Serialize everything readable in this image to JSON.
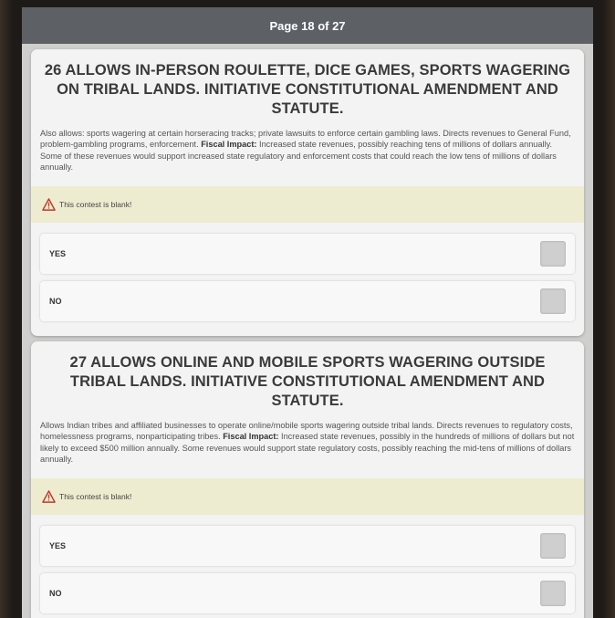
{
  "header": {
    "page_indicator": "Page 18 of 27"
  },
  "contests": [
    {
      "title": "26 ALLOWS IN-PERSON ROULETTE, DICE GAMES, SPORTS WAGERING ON TRIBAL LANDS. INITIATIVE CONSTITUTIONAL AMENDMENT AND STATUTE.",
      "desc_pre": "Also allows: sports wagering at certain horseracing tracks; private lawsuits to enforce certain gambling laws. Directs revenues to General Fund, problem-gambling programs, enforcement. ",
      "desc_bold": "Fiscal Impact:",
      "desc_post": " Increased state revenues, possibly reaching tens of millions of dollars annually. Some of these revenues would support increased state regulatory and enforcement costs that could reach the low tens of millions of dollars annually.",
      "warning": "This contest is blank!",
      "options": [
        "YES",
        "NO"
      ]
    },
    {
      "title": "27 ALLOWS ONLINE AND MOBILE SPORTS WAGERING OUTSIDE TRIBAL LANDS. INITIATIVE CONSTITUTIONAL AMENDMENT AND STATUTE.",
      "desc_pre": "Allows Indian tribes and affiliated businesses to operate online/mobile sports wagering outside tribal lands. Directs revenues to regulatory costs, homelessness programs, nonparticipating tribes. ",
      "desc_bold": "Fiscal Impact:",
      "desc_post": " Increased state revenues, possibly in the hundreds of millions of dollars but not likely to exceed $500 million annually. Some revenues would support state regulatory costs, possibly reaching the mid-tens of millions of dollars annually.",
      "warning": "This contest is blank!",
      "options": [
        "YES",
        "NO"
      ]
    }
  ],
  "colors": {
    "warning_bg": "#eeecd0",
    "header_bg": "#5d6166",
    "warning_icon": "#c0392b"
  }
}
